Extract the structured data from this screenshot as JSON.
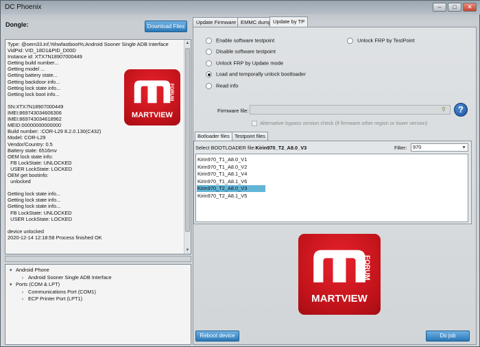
{
  "window": {
    "title": "DC Phoenix",
    "minimize_glyph": "–",
    "maximize_glyph": "□",
    "close_glyph": "✕"
  },
  "left": {
    "dongle_label": "Dongle:",
    "download_button": "Download Files",
    "log_lines": [
      "Type: @oem33.inf,%hwfastboot%;Android Sooner Single ADB Interface",
      "VidPid: VID_18D1&PID_D00D",
      "Instance id: XTX7N18907000449",
      "Getting build number...",
      "Getting model ...",
      "Getting battery state...",
      "Getting backdoor info...",
      "Getting lock state info...",
      "Getting lock boot info...",
      "",
      "SN:XTX7N18907000449",
      "IMEI:869743034606306",
      "IMEI:869743034618962",
      "MEID:00000000000000",
      "Build number: :COR-L29 8.2.0.130(C432)",
      "Model: COR-L29",
      "Vendor/Country: 0.5",
      "Battery state: 6516mv",
      "OEM lock state info:",
      "  FB LockState: UNLOCKED",
      "  USER LockState: LOCKED",
      "OEM get bootinfo:",
      "  unlocked",
      "",
      "Getting lock state info...",
      "Getting lock state info...",
      "Getting lock state info...",
      "  FB LockState: UNLOCKED",
      "  USER LockState: LOCKED",
      "",
      "device unlocked",
      "2020-12-14 12:18:58 Process finished OK"
    ],
    "device_tree": [
      {
        "label": "Android Phone",
        "arrow": "▾",
        "indent": 0
      },
      {
        "label": "Android Sooner Single ADB Interface",
        "arrow": "›",
        "indent": 1
      },
      {
        "label": "Ports (COM & LPT)",
        "arrow": "▾",
        "indent": 0
      },
      {
        "label": "Communications Port (COM1)",
        "arrow": "›",
        "indent": 1
      },
      {
        "label": "ECP Printer Port (LPT1)",
        "arrow": "›",
        "indent": 1
      }
    ]
  },
  "logo": {
    "brand": "MARTVIEW",
    "forum": "FORUM",
    "color": "#d01820"
  },
  "tabs": [
    "Update Firmware",
    "EMMC dump",
    "Update by TP"
  ],
  "active_tab": "Update by TP",
  "options": {
    "enable_testpoint": "Enable software testpoint",
    "disable_testpoint": "Disable software testpoint",
    "unlock_frp_update": "Unlock FRP by Update mode",
    "load_unlock_bootloader": "Load and temporally unlock bootloader",
    "read_info": "Read info",
    "unlock_frp_testpoint": "Unlock FRP by TestPoint",
    "selected": "Load and temporally unlock bootloader"
  },
  "firmware": {
    "label": "Firmware file:",
    "value": "",
    "help_glyph": "?",
    "alt_bypass_label": "Alternative bypass version check (if firmware other region or lower version)",
    "alt_bypass_checked": false
  },
  "subtabs": [
    "Botloader files",
    "Testpoint files"
  ],
  "active_subtab": "Botloader files",
  "bootloader": {
    "select_label": "Select BOOTLOADER file:",
    "selected_file": "Kirin970_T2_A8.0_V3",
    "filter_label": "Filter:",
    "filter_value": "970",
    "filter_icon": "filter-icon",
    "files": [
      "Kirin970_T1_A8.0_V1",
      "Kirin970_T1_A8.0_V2",
      "Kirin970_T1_A8.1_V4",
      "Kirin970_T1_A8.1_V6",
      "Kirin970_T2_A8.0_V3",
      "Kirin970_T2_A8.1_V5"
    ],
    "selected_index": 4
  },
  "buttons": {
    "reboot": "Reboot device",
    "do_job": "Do job"
  }
}
